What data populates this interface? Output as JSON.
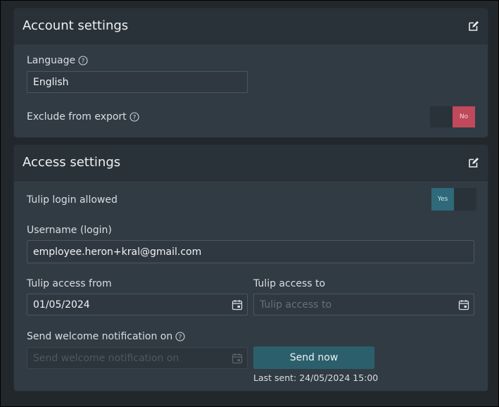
{
  "account": {
    "title": "Account settings",
    "language_label": "Language",
    "language_value": "English",
    "exclude_label": "Exclude from export",
    "exclude_toggle": {
      "value": "No",
      "color": "#c0495b"
    }
  },
  "access": {
    "title": "Access settings",
    "login_label": "Tulip login allowed",
    "login_toggle": {
      "value": "Yes",
      "color": "#2e6a79"
    },
    "username_label": "Username (login)",
    "username_value": "employee.heron+kral@gmail.com",
    "from_label": "Tulip access from",
    "from_value": "01/05/2024",
    "to_label": "Tulip access to",
    "to_placeholder": "Tulip access to",
    "welcome_label": "Send welcome notification on",
    "welcome_placeholder": "Send welcome notification on",
    "send_button": "Send now",
    "last_sent": "Last sent: 24/05/2024 15:00"
  },
  "icons": {
    "edit": "edit-icon",
    "help": "help-circle-icon",
    "calendar": "calendar-icon"
  }
}
